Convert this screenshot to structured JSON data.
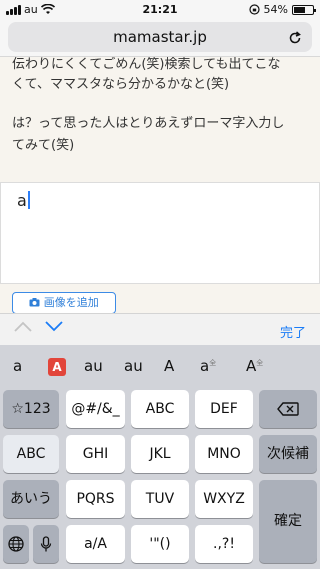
{
  "status": {
    "carrier": "au",
    "time": "21:21",
    "battery": "54%"
  },
  "url": "mamastar.jp",
  "article": {
    "lines": [
      "伝わりにくくてごめん(笑)検索しても出てこな",
      "くて、ママスタなら分かるかなと(笑)",
      "は？って思った人はとりあえずローマ字入力し",
      "てみて(笑)"
    ]
  },
  "textarea": {
    "value": "a"
  },
  "add_image": "画像を追加",
  "accessory": {
    "done": "完了"
  },
  "candidates": [
    "a",
    "A",
    "au",
    "au",
    "A",
    "a",
    "全",
    "A",
    "全"
  ],
  "keys": {
    "r1": [
      "☆123",
      "@#/&_",
      "ABC",
      "DEF"
    ],
    "r2": [
      "ABC",
      "GHI",
      "JKL",
      "MNO",
      "次候補"
    ],
    "r3": [
      "あいう",
      "PQRS",
      "TUV",
      "WXYZ",
      "確定"
    ],
    "r4": [
      "a/A",
      "'\"()",
      ".,?!"
    ]
  },
  "icons": {
    "wifi": "wifi-icon",
    "reload": "reload-icon",
    "camera": "camera-icon",
    "backspace": "backspace-icon",
    "globe": "globe-icon",
    "mic": "microphone-icon"
  },
  "colors": {
    "accent": "#1a7cf7",
    "keyboard_bg": "#d1d3d9",
    "battery_level": 0.54
  }
}
